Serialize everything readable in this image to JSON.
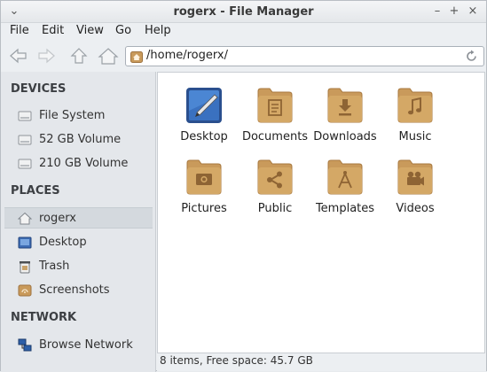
{
  "window": {
    "title": "rogerx - File Manager"
  },
  "window_controls": {
    "menu": "⌄",
    "minimize": "–",
    "maximize": "+",
    "close": "×"
  },
  "menubar": [
    "File",
    "Edit",
    "View",
    "Go",
    "Help"
  ],
  "location": {
    "path": "/home/rogerx/"
  },
  "sidebar": {
    "devices_header": "DEVICES",
    "devices": [
      "File System",
      "52 GB Volume",
      "210 GB Volume"
    ],
    "places_header": "PLACES",
    "places": [
      "rogerx",
      "Desktop",
      "Trash",
      "Screenshots"
    ],
    "network_header": "NETWORK",
    "network": [
      "Browse Network"
    ]
  },
  "files": [
    "Desktop",
    "Documents",
    "Downloads",
    "Music",
    "Pictures",
    "Public",
    "Templates",
    "Videos"
  ],
  "status": "8 items, Free space: 45.7 GB",
  "colors": {
    "folder": "#c99a5b",
    "folder_dark": "#a8783f",
    "selection": "#d4d9de"
  }
}
